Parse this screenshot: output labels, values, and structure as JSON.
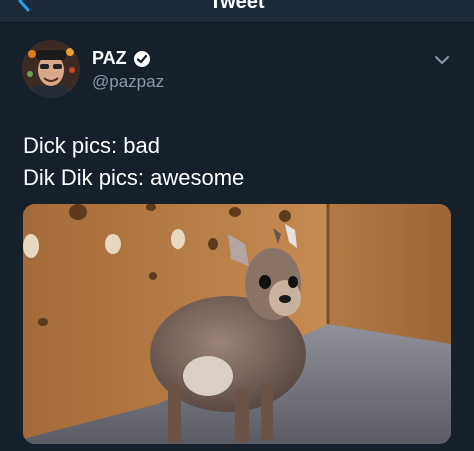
{
  "topbar": {
    "title": "Tweet"
  },
  "user": {
    "display_name": "PAZ",
    "handle": "@pazpaz"
  },
  "tweet": {
    "lines": [
      "Dick pics: bad",
      "Dik Dik pics: awesome"
    ]
  },
  "icons": {
    "back": "chevron-left-icon",
    "verified": "verified-badge-icon",
    "more": "chevron-down-icon"
  },
  "colors": {
    "background": "#15202b",
    "topbar": "#1c2938",
    "accent": "#1da1f2",
    "secondary_text": "#8899a6"
  }
}
